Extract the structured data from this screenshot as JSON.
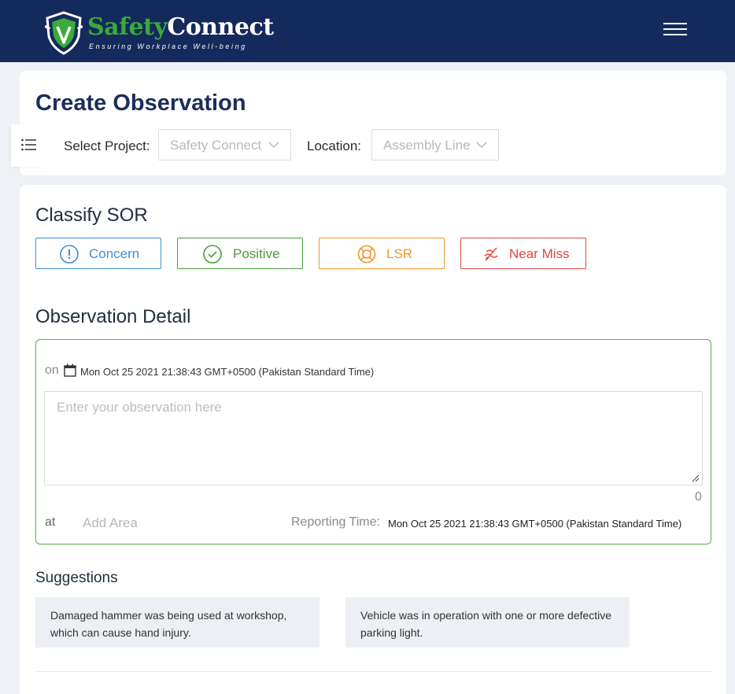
{
  "brand": {
    "name_part1": "Safety",
    "name_part2": "Connect",
    "tagline": "Ensuring Workplace Well-being"
  },
  "page": {
    "title": "Create Observation"
  },
  "filters": {
    "project_label": "Select Project",
    "project_value": "Safety Connect",
    "location_label": "Location",
    "location_value": "Assembly Line"
  },
  "classify": {
    "title": "Classify SOR",
    "options": [
      {
        "label": "Concern",
        "color": "#3d8fd6",
        "icon": "exclamation-circle-icon"
      },
      {
        "label": "Positive",
        "color": "#4a9d3a",
        "icon": "check-circle-icon"
      },
      {
        "label": "LSR",
        "color": "#f0952b",
        "icon": "lifebuoy-icon"
      },
      {
        "label": "Near Miss",
        "color": "#e0493e",
        "icon": "near-miss-icon"
      }
    ]
  },
  "detail": {
    "title": "Observation Detail",
    "on_label": "on",
    "datetime": "Mon Oct 25 2021 21:38:43 GMT+0500 (Pakistan Standard Time)",
    "placeholder": "Enter your observation here",
    "char_count": "0",
    "at_label": "at",
    "area_placeholder": "Add Area",
    "reporting_label": "Reporting Time:",
    "reporting_value": "Mon Oct 25 2021 21:38:43 GMT+0500 (Pakistan Standard Time)"
  },
  "suggestions": {
    "title": "Suggestions",
    "items": [
      {
        "line1": "Damaged hammer was being used at workshop,",
        "line2": "which can cause hand injury."
      },
      {
        "line1": "Vehicle was in operation with one or more defective",
        "line2": "parking light."
      }
    ]
  }
}
